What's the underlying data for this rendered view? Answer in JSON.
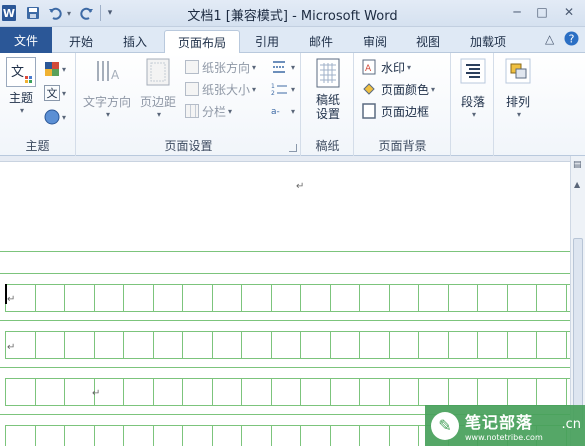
{
  "window": {
    "title": "文档1 [兼容模式] - Microsoft Word",
    "logo_letter": "W",
    "controls": [
      "─",
      "□",
      "✕"
    ]
  },
  "qat": {
    "save_icon": "save-icon",
    "undo_icon": "undo-icon",
    "redo_icon": "redo-icon"
  },
  "tabs": {
    "file": "文件",
    "items": [
      "开始",
      "插入",
      "页面布局",
      "引用",
      "邮件",
      "审阅",
      "视图",
      "加载项"
    ],
    "active": "页面布局"
  },
  "ribbon": {
    "theme_group": {
      "label": "主题",
      "theme_button": "主题",
      "theme_letter": "文"
    },
    "page_setup": {
      "label": "页面设置",
      "text_direction": "文字方向",
      "margins": "页边距",
      "orientation": "纸张方向",
      "size": "纸张大小",
      "columns": "分栏"
    },
    "manuscript": {
      "label": "稿纸",
      "button_line1": "稿纸",
      "button_line2": "设置"
    },
    "background": {
      "label": "页面背景",
      "watermark": "水印",
      "page_color": "页面颜色",
      "page_border": "页面边框"
    },
    "paragraph": {
      "label": "段落"
    },
    "arrange": {
      "label": "排列"
    }
  },
  "overlay": {
    "brand": "笔记部落",
    "domain": "www.notetribe.com",
    "suffix": ".cn"
  },
  "colors": {
    "accent": "#2b5797",
    "grid": "#7cc47c",
    "watermark": "#46a05a"
  }
}
